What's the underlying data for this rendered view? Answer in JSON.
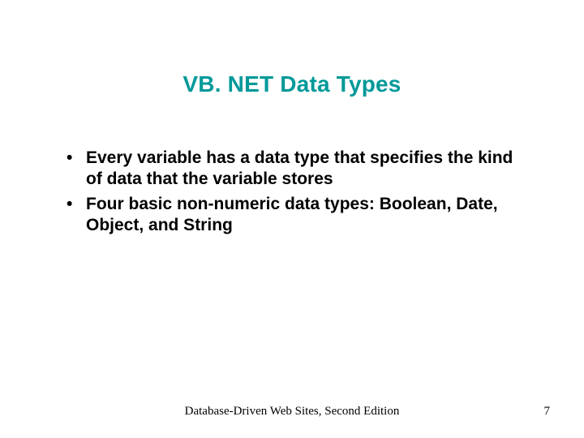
{
  "title": "VB. NET Data Types",
  "bullets": [
    "Every variable has a data type that specifies the kind of data that the variable stores",
    "Four basic non-numeric data types:  Boolean, Date, Object, and String"
  ],
  "footer": "Database-Driven Web Sites, Second Edition",
  "page_number": "7"
}
